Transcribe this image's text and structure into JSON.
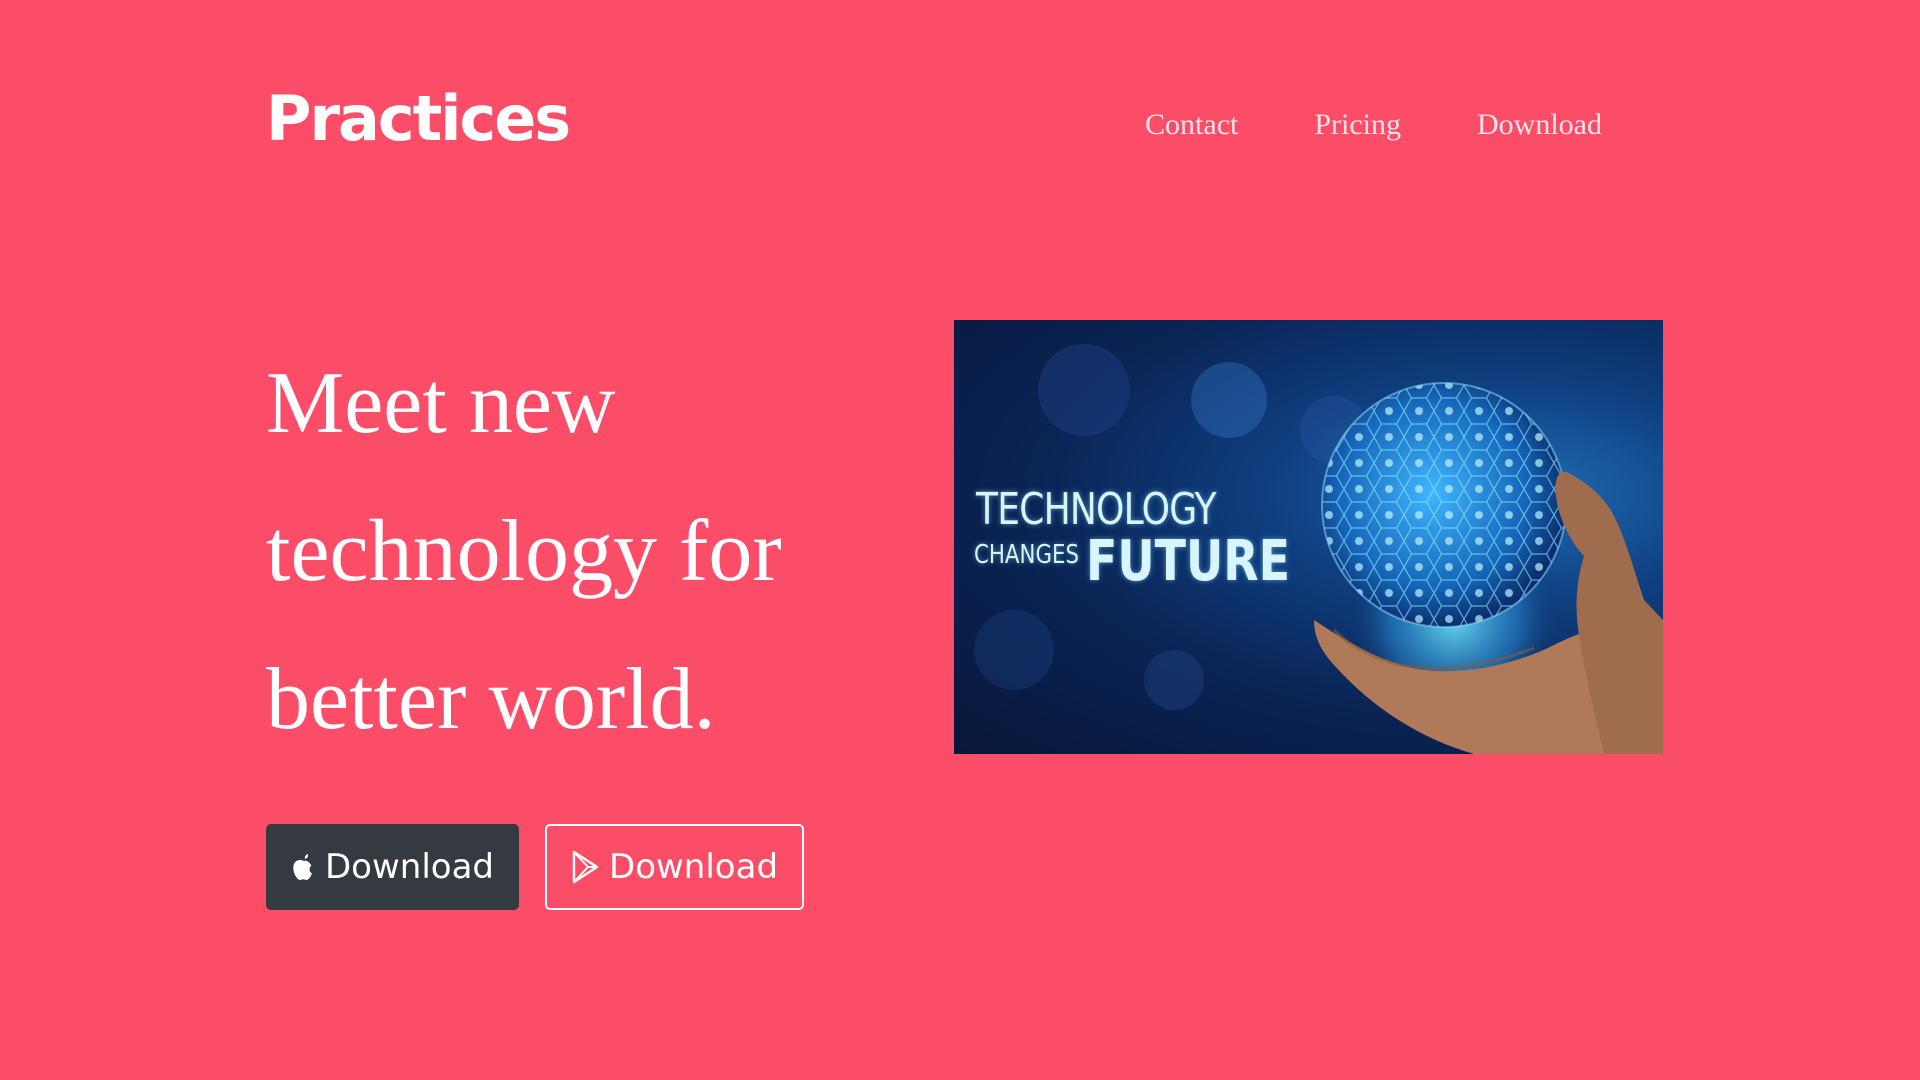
{
  "header": {
    "brand": "Practices",
    "nav": [
      {
        "label": "Contact"
      },
      {
        "label": "Pricing"
      },
      {
        "label": "Download"
      }
    ]
  },
  "hero": {
    "headline": "Meet new technology for better world.",
    "buttons": [
      {
        "label": "Download",
        "icon": "apple-icon",
        "style": "dark"
      },
      {
        "label": "Download",
        "icon": "google-play-icon",
        "style": "outline"
      }
    ],
    "image": {
      "line1": "TECHNOLOGY",
      "line2": "CHANGES",
      "line3": "FUTURE"
    }
  },
  "colors": {
    "background": "#fb4d68",
    "button_dark": "#343a40",
    "text": "#ffffff"
  }
}
